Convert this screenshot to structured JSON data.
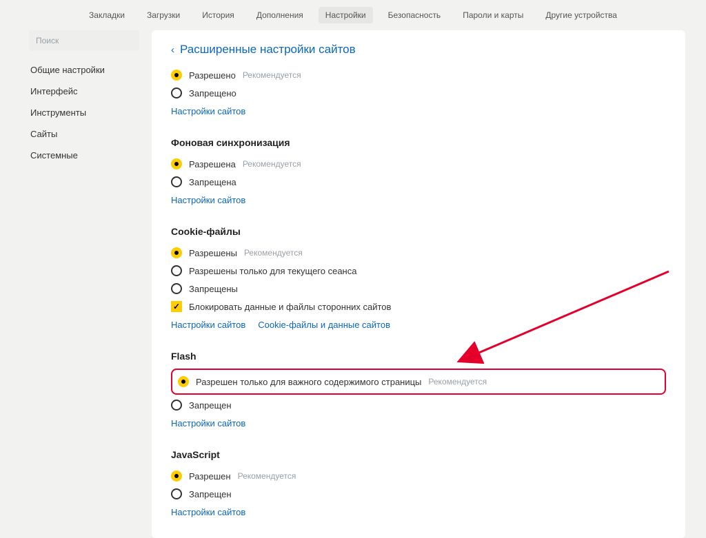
{
  "topnav": {
    "items": [
      "Закладки",
      "Загрузки",
      "История",
      "Дополнения",
      "Настройки",
      "Безопасность",
      "Пароли и карты",
      "Другие устройства"
    ],
    "active": "Настройки"
  },
  "sidebar": {
    "search_placeholder": "Поиск",
    "items": [
      "Общие настройки",
      "Интерфейс",
      "Инструменты",
      "Сайты",
      "Системные"
    ]
  },
  "page": {
    "title": "Расширенные настройки сайтов",
    "rec": "Рекомендуется",
    "site_settings_link": "Настройки сайтов",
    "cookie_link": "Cookie-файлы и данные сайтов"
  },
  "sec0": {
    "opt_allow": "Разрешено",
    "opt_deny": "Запрещено"
  },
  "sec1": {
    "title": "Фоновая синхронизация",
    "opt_allow": "Разрешена",
    "opt_deny": "Запрещена"
  },
  "sec2": {
    "title": "Cookie-файлы",
    "opt_allow": "Разрешены",
    "opt_session": "Разрешены только для текущего сеанса",
    "opt_deny": "Запрещены",
    "opt_block3p": "Блокировать данные и файлы сторонних сайтов"
  },
  "sec3": {
    "title": "Flash",
    "opt_important": "Разрешен только для важного содержимого страницы",
    "opt_deny": "Запрещен"
  },
  "sec4": {
    "title": "JavaScript",
    "opt_allow": "Разрешен",
    "opt_deny": "Запрещен"
  }
}
